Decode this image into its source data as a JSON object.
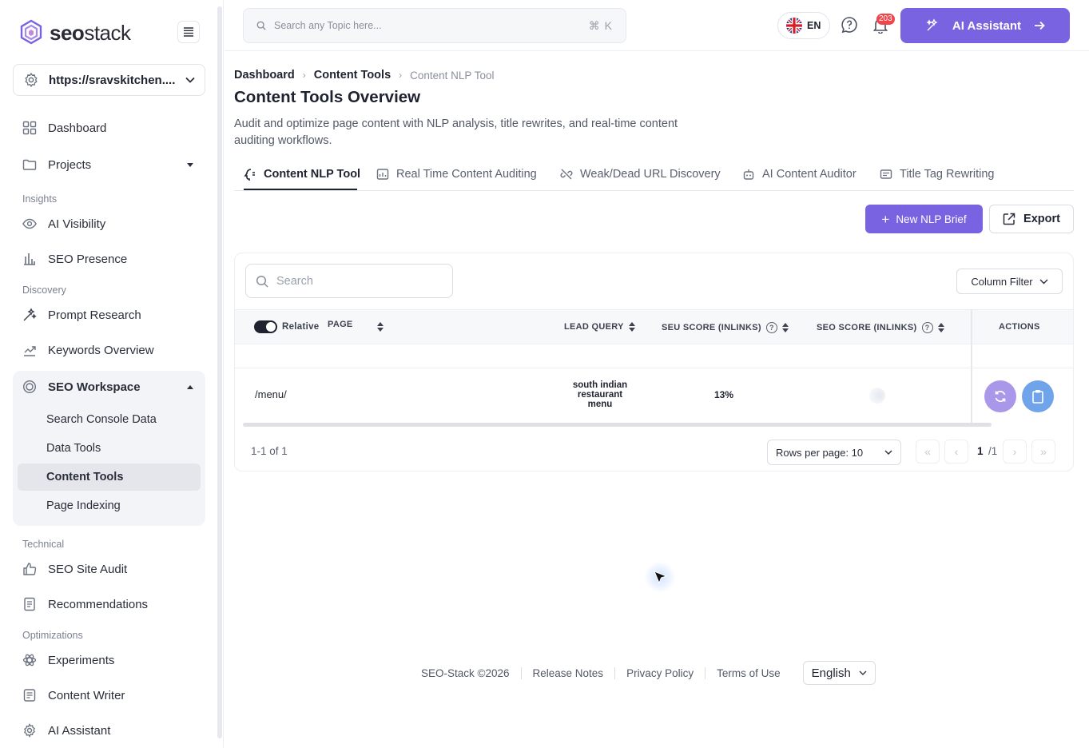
{
  "brand": {
    "name_bold": "seo",
    "name_light": "stack"
  },
  "site_selector": {
    "value": "https://sravskitchen...."
  },
  "sidebar": {
    "items": [
      {
        "label": "Dashboard"
      },
      {
        "label": "Projects"
      }
    ],
    "sections": [
      {
        "label": "Insights",
        "items": [
          {
            "label": "AI Visibility"
          },
          {
            "label": "SEO Presence"
          }
        ]
      },
      {
        "label": "Discovery",
        "items": [
          {
            "label": "Prompt Research"
          },
          {
            "label": "Keywords Overview"
          }
        ]
      },
      {
        "label": "SEO Workspace",
        "children": [
          {
            "label": "Search Console Data"
          },
          {
            "label": "Data Tools"
          },
          {
            "label": "Content Tools"
          },
          {
            "label": "Page Indexing"
          }
        ]
      },
      {
        "label": "Technical",
        "items": [
          {
            "label": "SEO Site Audit"
          },
          {
            "label": "Recommendations"
          }
        ]
      },
      {
        "label": "Optimizations",
        "items": [
          {
            "label": "Experiments"
          },
          {
            "label": "Content Writer"
          },
          {
            "label": "AI Assistant"
          }
        ]
      }
    ]
  },
  "header": {
    "search_placeholder": "Search any Topic here...",
    "search_shortcut": "⌘ K",
    "language": "EN",
    "notification_count": "203",
    "ai_button": "AI Assistant"
  },
  "breadcrumb": [
    "Dashboard",
    "Content Tools",
    "Content NLP Tool"
  ],
  "page": {
    "title": "Content Tools Overview",
    "description": "Audit and optimize page content with NLP analysis, title rewrites, and real-time content auditing workflows."
  },
  "tabs": [
    {
      "label": "Content NLP Tool",
      "active": true
    },
    {
      "label": "Real Time Content Auditing"
    },
    {
      "label": "Weak/Dead URL Discovery"
    },
    {
      "label": "AI Content Auditor"
    },
    {
      "label": "Title Tag Rewriting"
    }
  ],
  "toolbar": {
    "new_brief": "New NLP Brief",
    "export": "Export"
  },
  "table": {
    "search_placeholder": "Search",
    "column_filter": "Column Filter",
    "toggle_label": "Relative",
    "columns": [
      "PAGE",
      "LEAD QUERY",
      "SEU SCORE (INLINKS)",
      "SEO SCORE (INLINKS)",
      "ACTIONS"
    ],
    "rows": [
      {
        "page": "/menu/",
        "lead_query": "south indian restaurant menu",
        "seu_score": "13%"
      }
    ],
    "count": "1-1 of 1",
    "rows_per_page": "Rows per page: 10",
    "page_current": "1",
    "page_total": "/1"
  },
  "footer": {
    "copyright": "SEO-Stack ©2026",
    "links": [
      "Release Notes",
      "Privacy Policy",
      "Terms of Use"
    ],
    "language": "English"
  },
  "colors": {
    "accent": "#7a63e0",
    "text": "#1f2330",
    "badge": "#f0454b"
  }
}
